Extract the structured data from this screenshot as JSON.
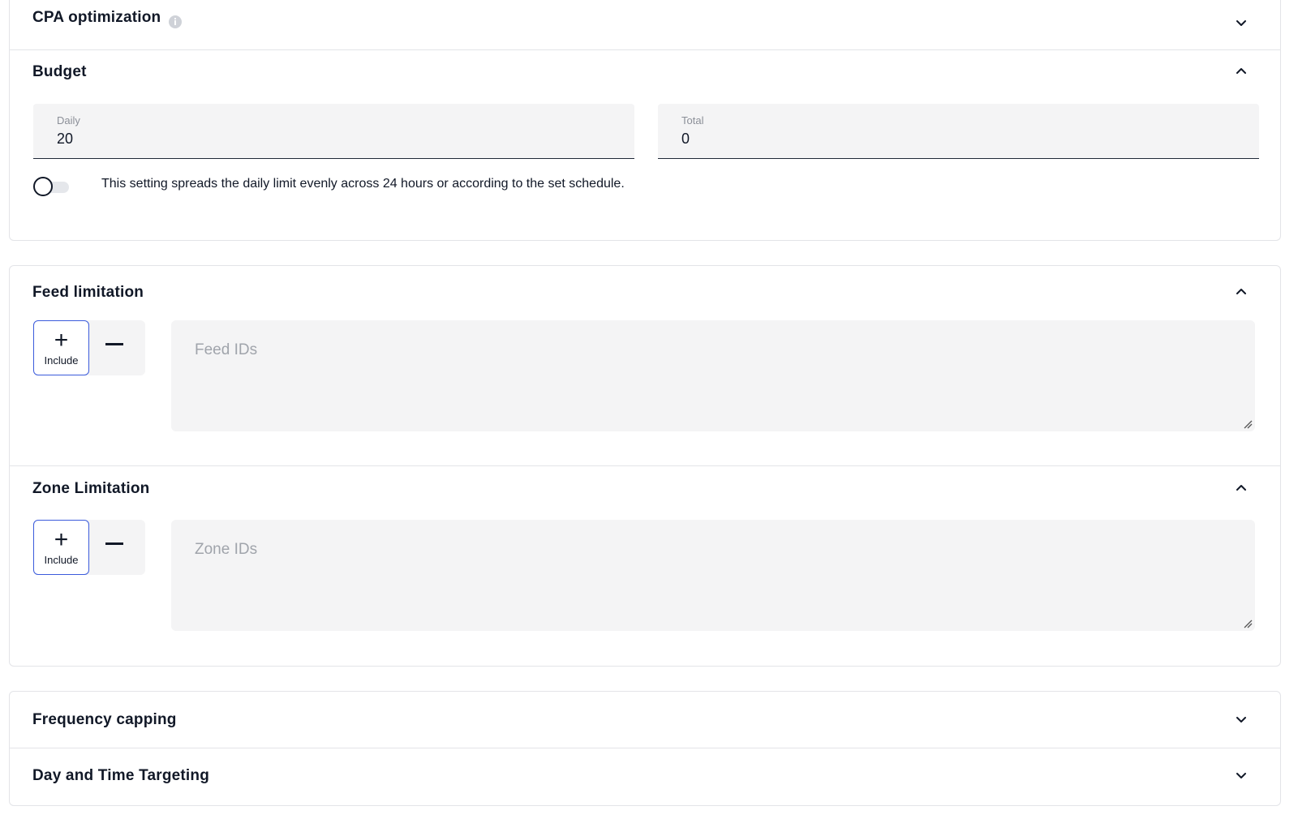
{
  "sections": {
    "cpa": {
      "title": "CPA optimization",
      "expanded": false
    },
    "budget": {
      "title": "Budget",
      "expanded": true,
      "daily": {
        "label": "Daily",
        "value": "20"
      },
      "total": {
        "label": "Total",
        "value": "0"
      },
      "spread_toggle": {
        "on": false,
        "text": "This setting spreads the daily limit evenly across 24 hours or according to the set schedule."
      }
    },
    "feed": {
      "title": "Feed limitation",
      "expanded": true,
      "mode_include_label": "Include",
      "placeholder": "Feed IDs"
    },
    "zone": {
      "title": "Zone Limitation",
      "expanded": true,
      "mode_include_label": "Include",
      "placeholder": "Zone IDs"
    },
    "frequency": {
      "title": "Frequency capping",
      "expanded": false
    },
    "daytime": {
      "title": "Day and Time Targeting",
      "expanded": false
    }
  },
  "colors": {
    "accent_border": "#3b5bdb",
    "field_bg": "#f4f4f5",
    "text": "#111827",
    "placeholder": "#a0a4ab"
  },
  "icons": [
    "info-icon",
    "chevron-down-icon",
    "chevron-up-icon",
    "plus-icon",
    "minus-icon",
    "resize-grip-icon"
  ]
}
